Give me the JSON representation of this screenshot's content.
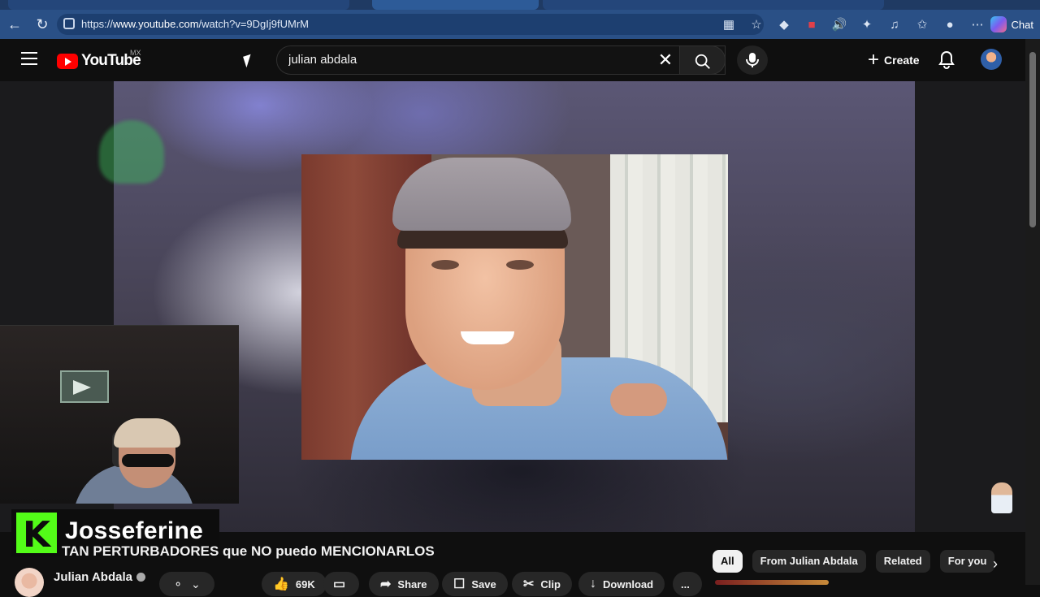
{
  "browser": {
    "url_prefix": "https://",
    "url_host": "www.youtube.com",
    "url_path": "/watch?v=9DgIj9fUMrM",
    "chat_label": "Chat"
  },
  "header": {
    "logo_text": "YouTube",
    "country_code": "MX",
    "search_value": "julian abdala",
    "create_label": "Create"
  },
  "overlay": {
    "streamer_name": "Josseferine"
  },
  "video": {
    "title": "TAN PERTURBADORES que NO puedo MENCIONARLOS",
    "channel_name": "Julian Abdala",
    "actions": {
      "likes": "69K",
      "share": "Share",
      "save": "Save",
      "clip": "Clip",
      "download": "Download",
      "more": "..."
    }
  },
  "chips": [
    "All",
    "From Julian Abdala",
    "Related",
    "For you"
  ],
  "colors": {
    "youtube_red": "#ff0000",
    "kick_green": "#53fc18",
    "browser_blue": "#2a5086"
  }
}
